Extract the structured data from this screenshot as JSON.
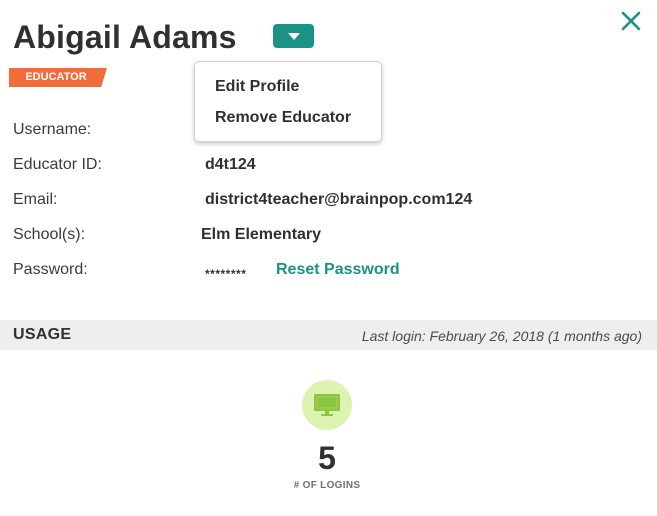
{
  "profile": {
    "name": "Abigail Adams",
    "role_badge": "EDUCATOR"
  },
  "actions_menu": {
    "items": [
      {
        "label": "Edit Profile"
      },
      {
        "label": "Remove Educator"
      }
    ]
  },
  "details": {
    "username": {
      "label": "Username:",
      "value": ""
    },
    "educator_id": {
      "label": "Educator ID:",
      "value": "d4t124"
    },
    "email": {
      "label": "Email:",
      "value": "district4teacher@brainpop.com124"
    },
    "schools": {
      "label": "School(s):",
      "value": "Elm Elementary"
    },
    "password": {
      "label": "Password:",
      "value": "********",
      "reset_label": "Reset Password"
    }
  },
  "usage": {
    "title": "USAGE",
    "last_login": "Last login: February 26, 2018 (1 months ago)",
    "logins": {
      "value": "5",
      "label": "# OF LOGINS",
      "icon": "monitor-icon"
    }
  },
  "icons": {
    "dropdown_toggle": "caret-down-icon",
    "close": "close-icon"
  },
  "colors": {
    "accent": "#1a9386",
    "badge": "#f26b3a",
    "usage_bar": "#eeeeee",
    "stat_circle": "#dff3b1",
    "stat_icon": "#8cc63f"
  }
}
